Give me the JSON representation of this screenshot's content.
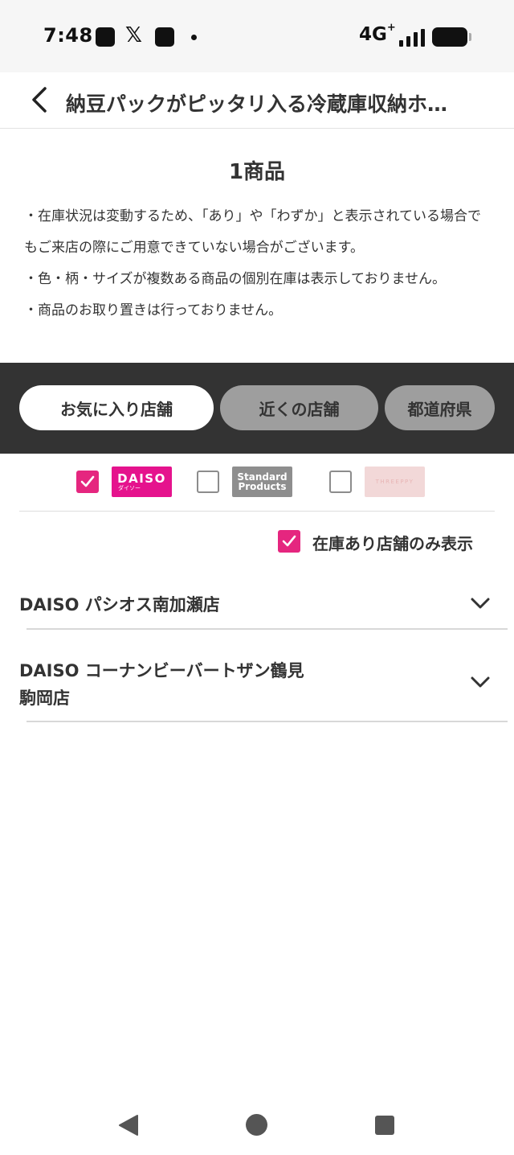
{
  "status_bar": {
    "time": "7:48",
    "network": "4G",
    "network_sup": "+"
  },
  "header": {
    "title": "納豆パックがピッタリ入る冷蔵庫収納ホ…"
  },
  "product_count": "1商品",
  "notes": [
    "・在庫状況は変動するため、「あり」や「わずか」と表示されている場合でもご来店の際にご用意できていない場合がございます。",
    "・色・柄・サイズが複数ある商品の個別在庫は表示しておりません。",
    "・商品のお取り置きは行っておりません。"
  ],
  "tabs": [
    {
      "label": "お気に入り店舗",
      "active": true
    },
    {
      "label": "近くの店舗",
      "active": false
    },
    {
      "label": "都道府県",
      "active": false
    }
  ],
  "brands": {
    "daiso": {
      "text": "DAISO",
      "subtext": "ダイソー",
      "checked": true,
      "color": "#e5138d"
    },
    "standard": {
      "line1": "Standard",
      "line2": "Products",
      "checked": false
    },
    "threeppy": {
      "text": "THREEPPY",
      "checked": false
    }
  },
  "stock_filter": {
    "label": "在庫あり店舗のみ表示",
    "checked": true
  },
  "stores": [
    {
      "name": "DAISO パシオス南加瀬店"
    },
    {
      "name_line1": "DAISO コーナンビーバートザン鶴見",
      "name_line2": "駒岡店"
    }
  ],
  "colors": {
    "accent": "#e5267f",
    "tab_band": "#333333",
    "inactive_tab": "#9e9e9e"
  }
}
